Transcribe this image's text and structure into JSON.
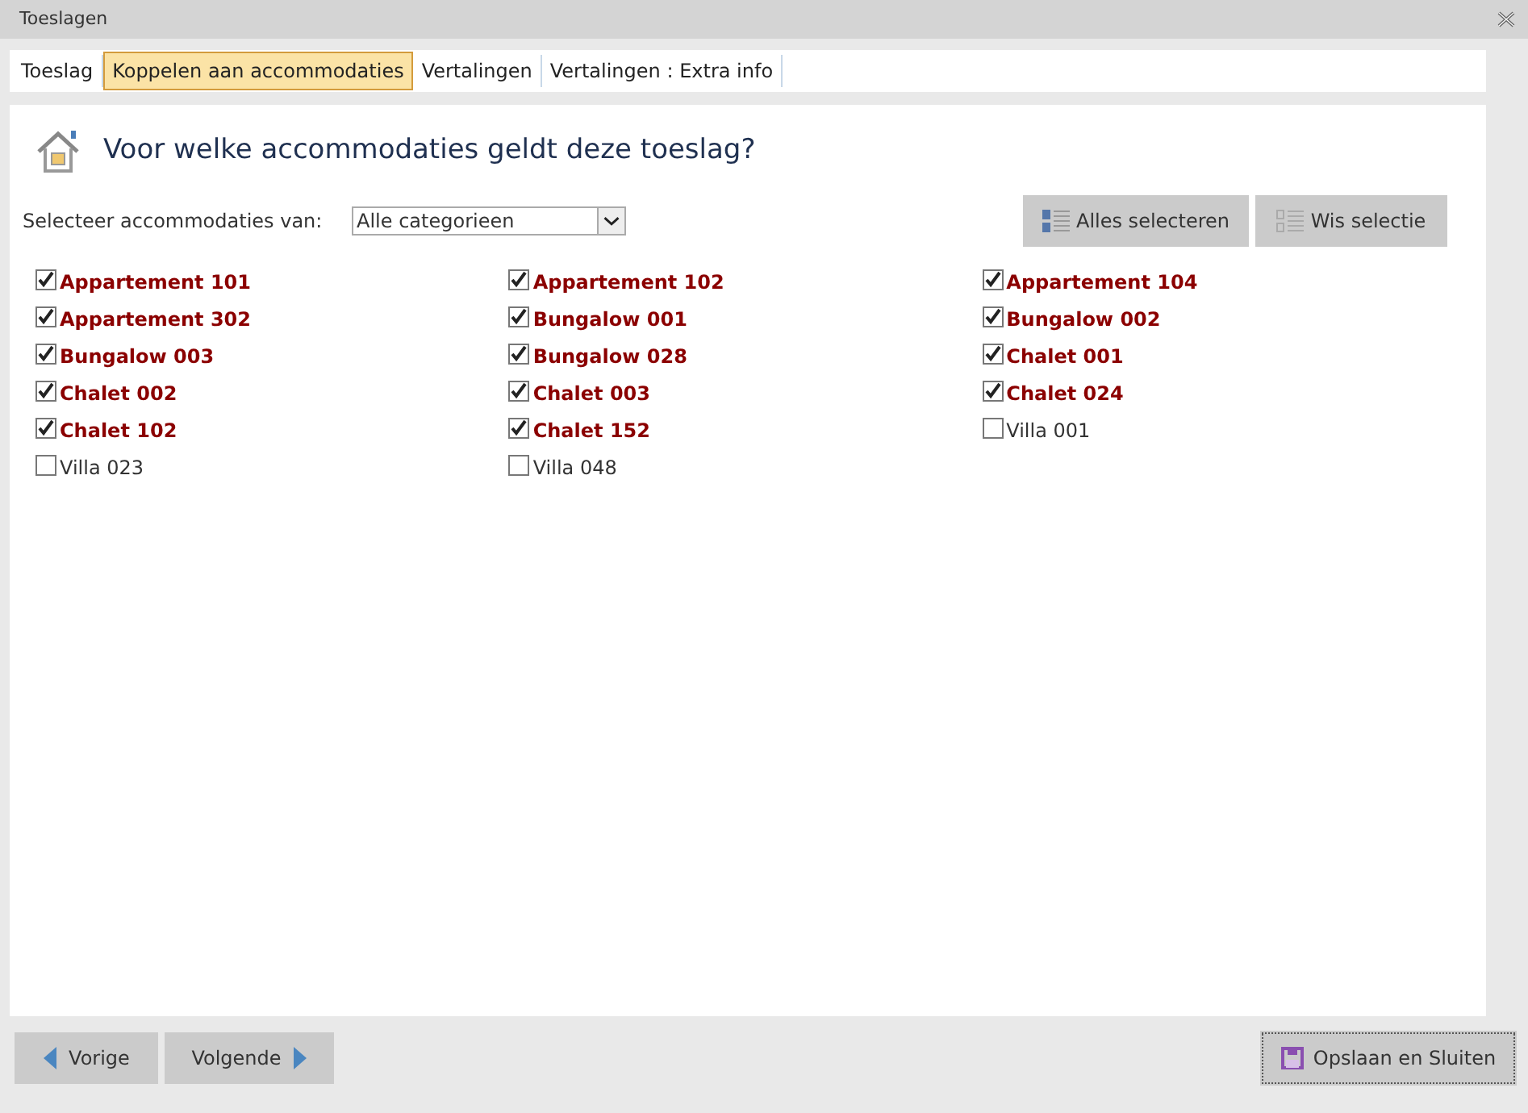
{
  "window": {
    "title": "Toeslagen"
  },
  "tabs": [
    {
      "label": "Toeslag",
      "selected": false
    },
    {
      "label": "Koppelen aan accommodaties",
      "selected": true
    },
    {
      "label": "Vertalingen",
      "selected": false
    },
    {
      "label": "Vertalingen : Extra info",
      "selected": false
    }
  ],
  "heading": "Voor welke accommodaties geldt deze toeslag?",
  "filter": {
    "label": "Selecteer accommodaties van:",
    "value": "Alle categorieen"
  },
  "actions": [
    "Alles selecteren",
    "Wis selectie"
  ],
  "accommodations": [
    {
      "label": "Appartement 101",
      "checked": true
    },
    {
      "label": "Appartement 102",
      "checked": true
    },
    {
      "label": "Appartement 104",
      "checked": true
    },
    {
      "label": "Appartement 302",
      "checked": true
    },
    {
      "label": "Bungalow 001",
      "checked": true
    },
    {
      "label": "Bungalow 002",
      "checked": true
    },
    {
      "label": "Bungalow 003",
      "checked": true
    },
    {
      "label": "Bungalow 028",
      "checked": true
    },
    {
      "label": "Chalet 001",
      "checked": true
    },
    {
      "label": "Chalet 002",
      "checked": true
    },
    {
      "label": "Chalet 003",
      "checked": true
    },
    {
      "label": "Chalet 024",
      "checked": true
    },
    {
      "label": "Chalet 102",
      "checked": true
    },
    {
      "label": "Chalet 152",
      "checked": true
    },
    {
      "label": "Villa 001",
      "checked": false
    },
    {
      "label": "Villa 023",
      "checked": false
    },
    {
      "label": "Villa 048",
      "checked": false
    }
  ],
  "footer": {
    "previous": "Vorige",
    "next": "Volgende",
    "save": "Opslaan en Sluiten"
  }
}
